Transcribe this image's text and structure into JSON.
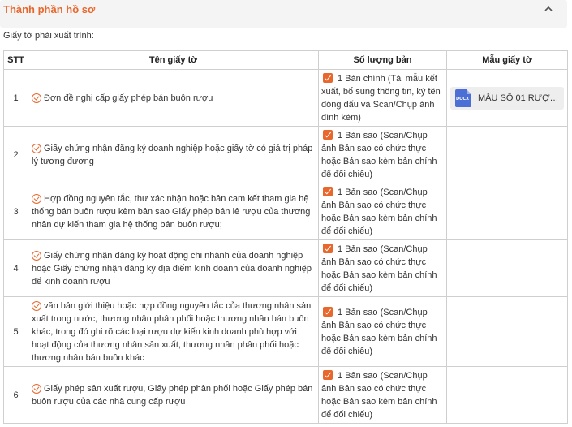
{
  "section": {
    "title": "Thành phần hồ sơ",
    "subtitle": "Giấy tờ phải xuất trình:"
  },
  "table": {
    "headers": [
      "STT",
      "Tên giấy tờ",
      "Số lượng bản",
      "Mẫu giấy tờ"
    ],
    "rows": [
      {
        "stt": "1",
        "name": "Đơn đề nghị cấp giấy phép bán buôn rượu",
        "qty": "1 Bản chính (Tải mẫu kết xuất, bổ sung thông tin, ký tên đóng dấu và Scan/Chụp ảnh đính kèm)",
        "template": {
          "file_name": "MẪU SỐ 01 RƯỢU.do...",
          "file_type": "DOCX"
        }
      },
      {
        "stt": "2",
        "name": "Giấy chứng nhận đăng ký doanh nghiệp hoặc giấy tờ có giá trị pháp lý tương đương",
        "qty": "1 Bản sao (Scan/Chụp ảnh Bản sao có chức thực hoặc Bản sao kèm bản chính để đối chiếu)"
      },
      {
        "stt": "3",
        "name": "Hợp đồng nguyên tắc, thư xác nhận hoặc bản cam kết tham gia hệ thống bán buôn rượu kèm bản sao Giấy phép bán lẻ rượu của thương nhân dự kiến tham gia hệ thống bán buôn rượu;",
        "qty": "1 Bản sao (Scan/Chụp ảnh Bản sao có chức thực hoặc Bản sao kèm bản chính để đối chiếu)"
      },
      {
        "stt": "4",
        "name": "Giấy chứng nhận đăng ký hoạt động chi nhánh của doanh nghiệp hoặc Giấy chứng nhận đăng ký địa điểm kinh doanh của doanh nghiệp để kinh doanh rượu",
        "qty": "1 Bản sao (Scan/Chụp ảnh Bản sao có chức thực hoặc Bản sao kèm bản chính để đối chiếu)"
      },
      {
        "stt": "5",
        "name": "văn bản giới thiệu hoặc hợp đồng nguyên tắc của thương nhân sản xuất trong nước, thương nhân phân phối hoặc thương nhân bán buôn khác, trong đó ghi rõ các loại rượu dự kiến kinh doanh phù hợp với hoạt động của thương nhân sản xuất, thương nhân phân phối hoặc thương nhân bán buôn khác",
        "qty": "1 Bản sao (Scan/Chụp ảnh Bản sao có chức thực hoặc Bản sao kèm bản chính để đối chiếu)"
      },
      {
        "stt": "6",
        "name": "Giấy phép sản xuất rượu, Giấy phép phân phối hoặc Giấy phép bán buôn rượu của các nhà cung cấp rượu",
        "qty": "1 Bản sao (Scan/Chụp ảnh Bản sao có chức thực hoặc Bản sao kèm bản chính để đối chiếu)"
      }
    ]
  },
  "colors": {
    "accent": "#e8672c",
    "file_icon": "#4c6fd6"
  },
  "icons": {
    "collapse": "chevron-up-icon",
    "status": "check-circle-icon",
    "checkbox": "checkbox-checked-icon",
    "file": "docx-file-icon"
  }
}
